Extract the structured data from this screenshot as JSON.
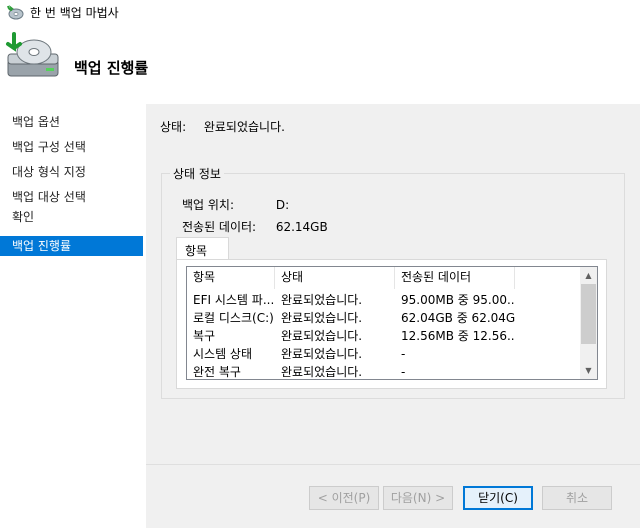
{
  "window": {
    "title": "한 번 백업 마법사"
  },
  "header": {
    "title": "백업 진행률"
  },
  "sidebar": {
    "items": [
      {
        "label": "백업 옵션"
      },
      {
        "label": "백업 구성 선택"
      },
      {
        "label": "대상 형식 지정"
      },
      {
        "label": "백업 대상 선택"
      },
      {
        "label": "확인"
      },
      {
        "label": "백업 진행률"
      }
    ],
    "selected_index": 5
  },
  "status": {
    "label": "상태:",
    "value": "완료되었습니다."
  },
  "group": {
    "legend": "상태 정보",
    "backup_location_label": "백업 위치:",
    "backup_location_value": "D:",
    "transferred_label": "전송된 데이터:",
    "transferred_value": "62.14GB"
  },
  "tab": {
    "label": "항목"
  },
  "table": {
    "columns": [
      "항목",
      "상태",
      "전송된 데이터"
    ],
    "rows": [
      [
        "EFI 시스템 파...",
        "완료되었습니다.",
        "95.00MB 중 95.00..."
      ],
      [
        "로컬 디스크(C:)",
        "완료되었습니다.",
        "62.04GB 중 62.04GB"
      ],
      [
        "복구",
        "완료되었습니다.",
        "12.56MB 중 12.56..."
      ],
      [
        "시스템 상태",
        "완료되었습니다.",
        "-"
      ],
      [
        "완전 복구",
        "완료되었습니다.",
        "-"
      ]
    ]
  },
  "buttons": {
    "prev": "< 이전(P)",
    "next": "다음(N) >",
    "close": "닫기(C)",
    "cancel": "취소"
  },
  "colors": {
    "selection": "#0078d7",
    "panel": "#f0f0f0"
  },
  "icons": {
    "app": "backup-wizard-icon",
    "header": "disk-backup-icon"
  }
}
